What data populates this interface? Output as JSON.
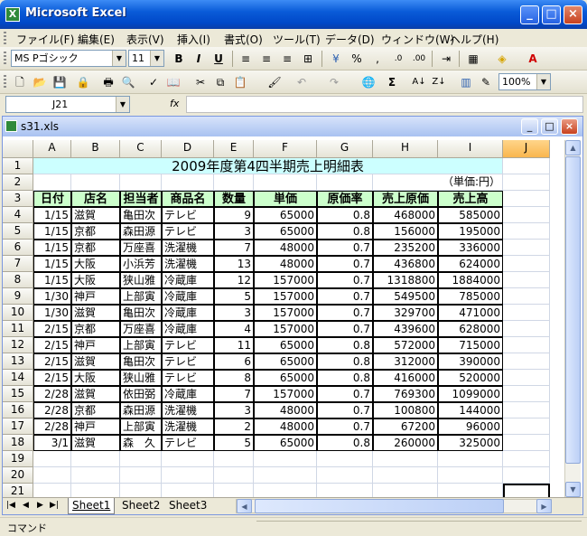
{
  "app": {
    "title": "Microsoft Excel"
  },
  "menu": [
    "ファイル(F)",
    "編集(E)",
    "表示(V)",
    "挿入(I)",
    "書式(O)",
    "ツール(T)",
    "データ(D)",
    "ウィンドウ(W)",
    "ヘルプ(H)"
  ],
  "format_toolbar": {
    "font_name": "MS Pゴシック",
    "font_size": "11",
    "bold": "B",
    "italic": "I",
    "underline": "U",
    "percent": "%",
    "comma": ","
  },
  "standard_toolbar": {
    "zoom": "100%",
    "sigma": "Σ"
  },
  "formula_bar": {
    "name_box": "J21",
    "fx": "fx",
    "formula": ""
  },
  "workbook": {
    "title": "s31.xls"
  },
  "columns": [
    "A",
    "B",
    "C",
    "D",
    "E",
    "F",
    "G",
    "H",
    "I",
    "J"
  ],
  "rows": [
    "1",
    "2",
    "3",
    "4",
    "5",
    "6",
    "7",
    "8",
    "9",
    "10",
    "11",
    "12",
    "13",
    "14",
    "15",
    "16",
    "17",
    "18",
    "19",
    "20",
    "21"
  ],
  "sheet": {
    "title": "2009年度第4四半期売上明細表",
    "unit_note": "（単価:円）",
    "headers": [
      "日付",
      "店名",
      "担当者",
      "商品名",
      "数量",
      "単価",
      "原価率",
      "売上原価",
      "売上高"
    ],
    "data": [
      [
        "1/15",
        "滋賀",
        "亀田次",
        "テレビ",
        "9",
        "65000",
        "0.8",
        "468000",
        "585000"
      ],
      [
        "1/15",
        "京都",
        "森田源",
        "テレビ",
        "3",
        "65000",
        "0.8",
        "156000",
        "195000"
      ],
      [
        "1/15",
        "京都",
        "万座喜",
        "洗濯機",
        "7",
        "48000",
        "0.7",
        "235200",
        "336000"
      ],
      [
        "1/15",
        "大阪",
        "小浜芳",
        "洗濯機",
        "13",
        "48000",
        "0.7",
        "436800",
        "624000"
      ],
      [
        "1/15",
        "大阪",
        "狭山雅",
        "冷蔵庫",
        "12",
        "157000",
        "0.7",
        "1318800",
        "1884000"
      ],
      [
        "1/30",
        "神戸",
        "上部寅",
        "冷蔵庫",
        "5",
        "157000",
        "0.7",
        "549500",
        "785000"
      ],
      [
        "1/30",
        "滋賀",
        "亀田次",
        "冷蔵庫",
        "3",
        "157000",
        "0.7",
        "329700",
        "471000"
      ],
      [
        "2/15",
        "京都",
        "万座喜",
        "冷蔵庫",
        "4",
        "157000",
        "0.7",
        "439600",
        "628000"
      ],
      [
        "2/15",
        "神戸",
        "上部寅",
        "テレビ",
        "11",
        "65000",
        "0.8",
        "572000",
        "715000"
      ],
      [
        "2/15",
        "滋賀",
        "亀田次",
        "テレビ",
        "6",
        "65000",
        "0.8",
        "312000",
        "390000"
      ],
      [
        "2/15",
        "大阪",
        "狭山雅",
        "テレビ",
        "8",
        "65000",
        "0.8",
        "416000",
        "520000"
      ],
      [
        "2/28",
        "滋賀",
        "依田弼",
        "冷蔵庫",
        "7",
        "157000",
        "0.7",
        "769300",
        "1099000"
      ],
      [
        "2/28",
        "京都",
        "森田源",
        "洗濯機",
        "3",
        "48000",
        "0.7",
        "100800",
        "144000"
      ],
      [
        "2/28",
        "神戸",
        "上部寅",
        "洗濯機",
        "2",
        "48000",
        "0.7",
        "67200",
        "96000"
      ],
      [
        "3/1",
        "滋賀",
        "森　久",
        "テレビ",
        "5",
        "65000",
        "0.8",
        "260000",
        "325000"
      ]
    ]
  },
  "sheet_tabs": [
    "Sheet1",
    "Sheet2",
    "Sheet3"
  ],
  "status": {
    "text": "コマンド"
  },
  "colors": {
    "title_fill": "#ccffff",
    "header_fill": "#ccffcc",
    "xp_blue": "#0a5bd8"
  }
}
